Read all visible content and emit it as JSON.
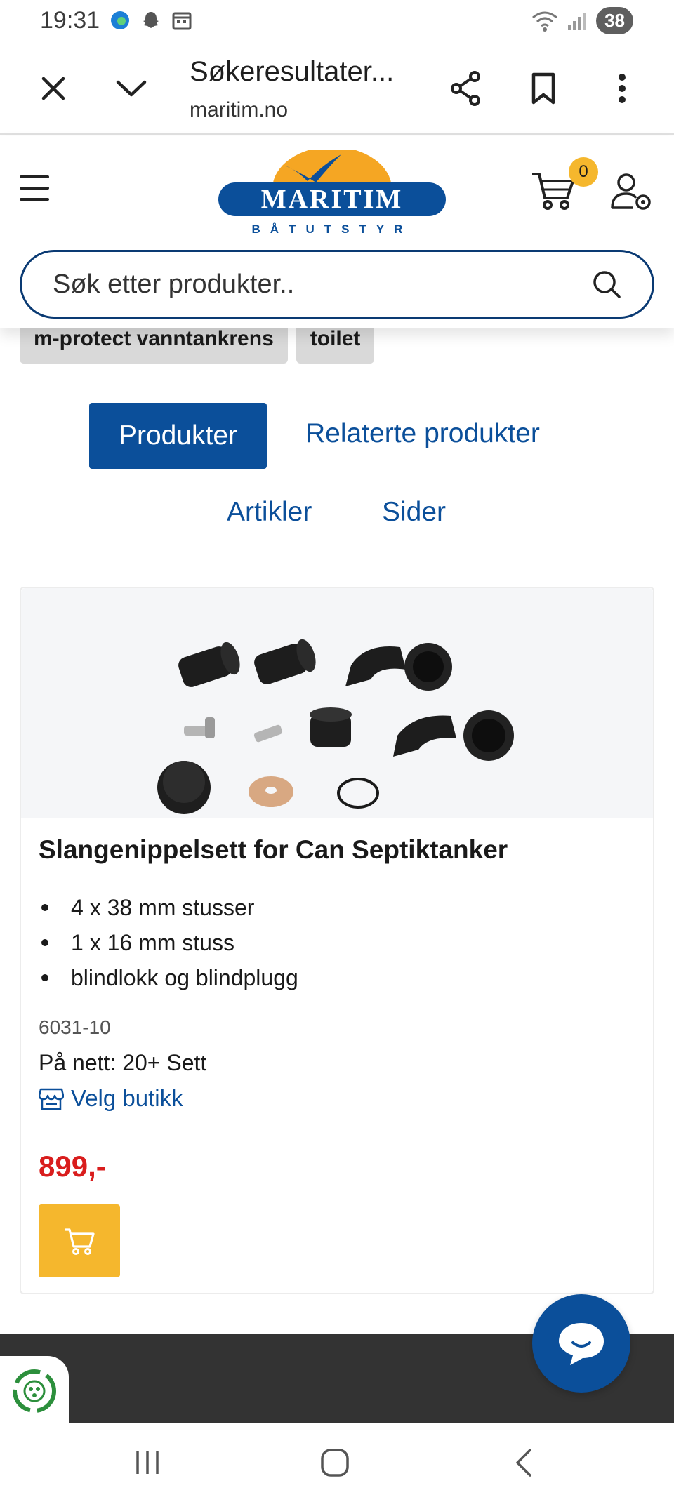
{
  "status_bar": {
    "time": "19:31",
    "battery": "38"
  },
  "browser": {
    "title": "Søkeresultater...",
    "url": "maritim.no"
  },
  "header": {
    "logo_text": "MARITIM",
    "logo_subtext": "BÅTUTSTYR",
    "cart_count": "0",
    "search_placeholder": "Søk etter produkter.."
  },
  "tags": [
    "m-protect vanntankrens",
    "toilet"
  ],
  "tabs": {
    "active": "Produkter",
    "related": "Relaterte produkter",
    "articles": "Artikler",
    "pages": "Sider"
  },
  "product": {
    "title": "Slangenippelsett for Can Septiktanker",
    "features": [
      "4 x 38 mm stusser",
      "1 x 16 mm stuss",
      "blindlokk og blindplugg"
    ],
    "sku": "6031-10",
    "stock": "På nett:  20+ Sett",
    "store_link": "Velg butikk",
    "price": "899,-"
  },
  "colors": {
    "brand_blue": "#0b4f9a",
    "accent_yellow": "#f5b72d",
    "price_red": "#d91d1d"
  }
}
